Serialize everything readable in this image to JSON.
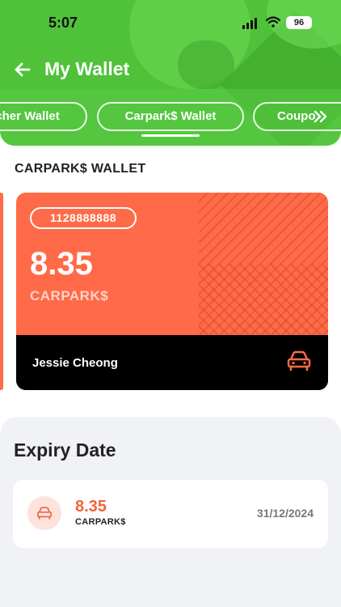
{
  "status_bar": {
    "time": "5:07",
    "battery": "96"
  },
  "header": {
    "title": "My Wallet",
    "tabs": [
      {
        "label": "cher Wallet"
      },
      {
        "label": "Carpark$ Wallet"
      },
      {
        "label": "Coupo"
      }
    ],
    "active_tab_index": 1
  },
  "section": {
    "title": "CARPARK$ WALLET"
  },
  "wallet_card": {
    "account_number": "1128888888",
    "amount": "8.35",
    "unit": "CARPARK$",
    "holder_name": "Jessie Cheong",
    "icon": "car-icon"
  },
  "expiry": {
    "title": "Expiry Date",
    "items": [
      {
        "amount": "8.35",
        "unit": "CARPARK$",
        "date": "31/12/2024",
        "icon": "car-icon"
      }
    ]
  },
  "colors": {
    "header_green": "#4fc23a",
    "card_orange": "#ff6a48",
    "accent_orange": "#f0643f"
  }
}
